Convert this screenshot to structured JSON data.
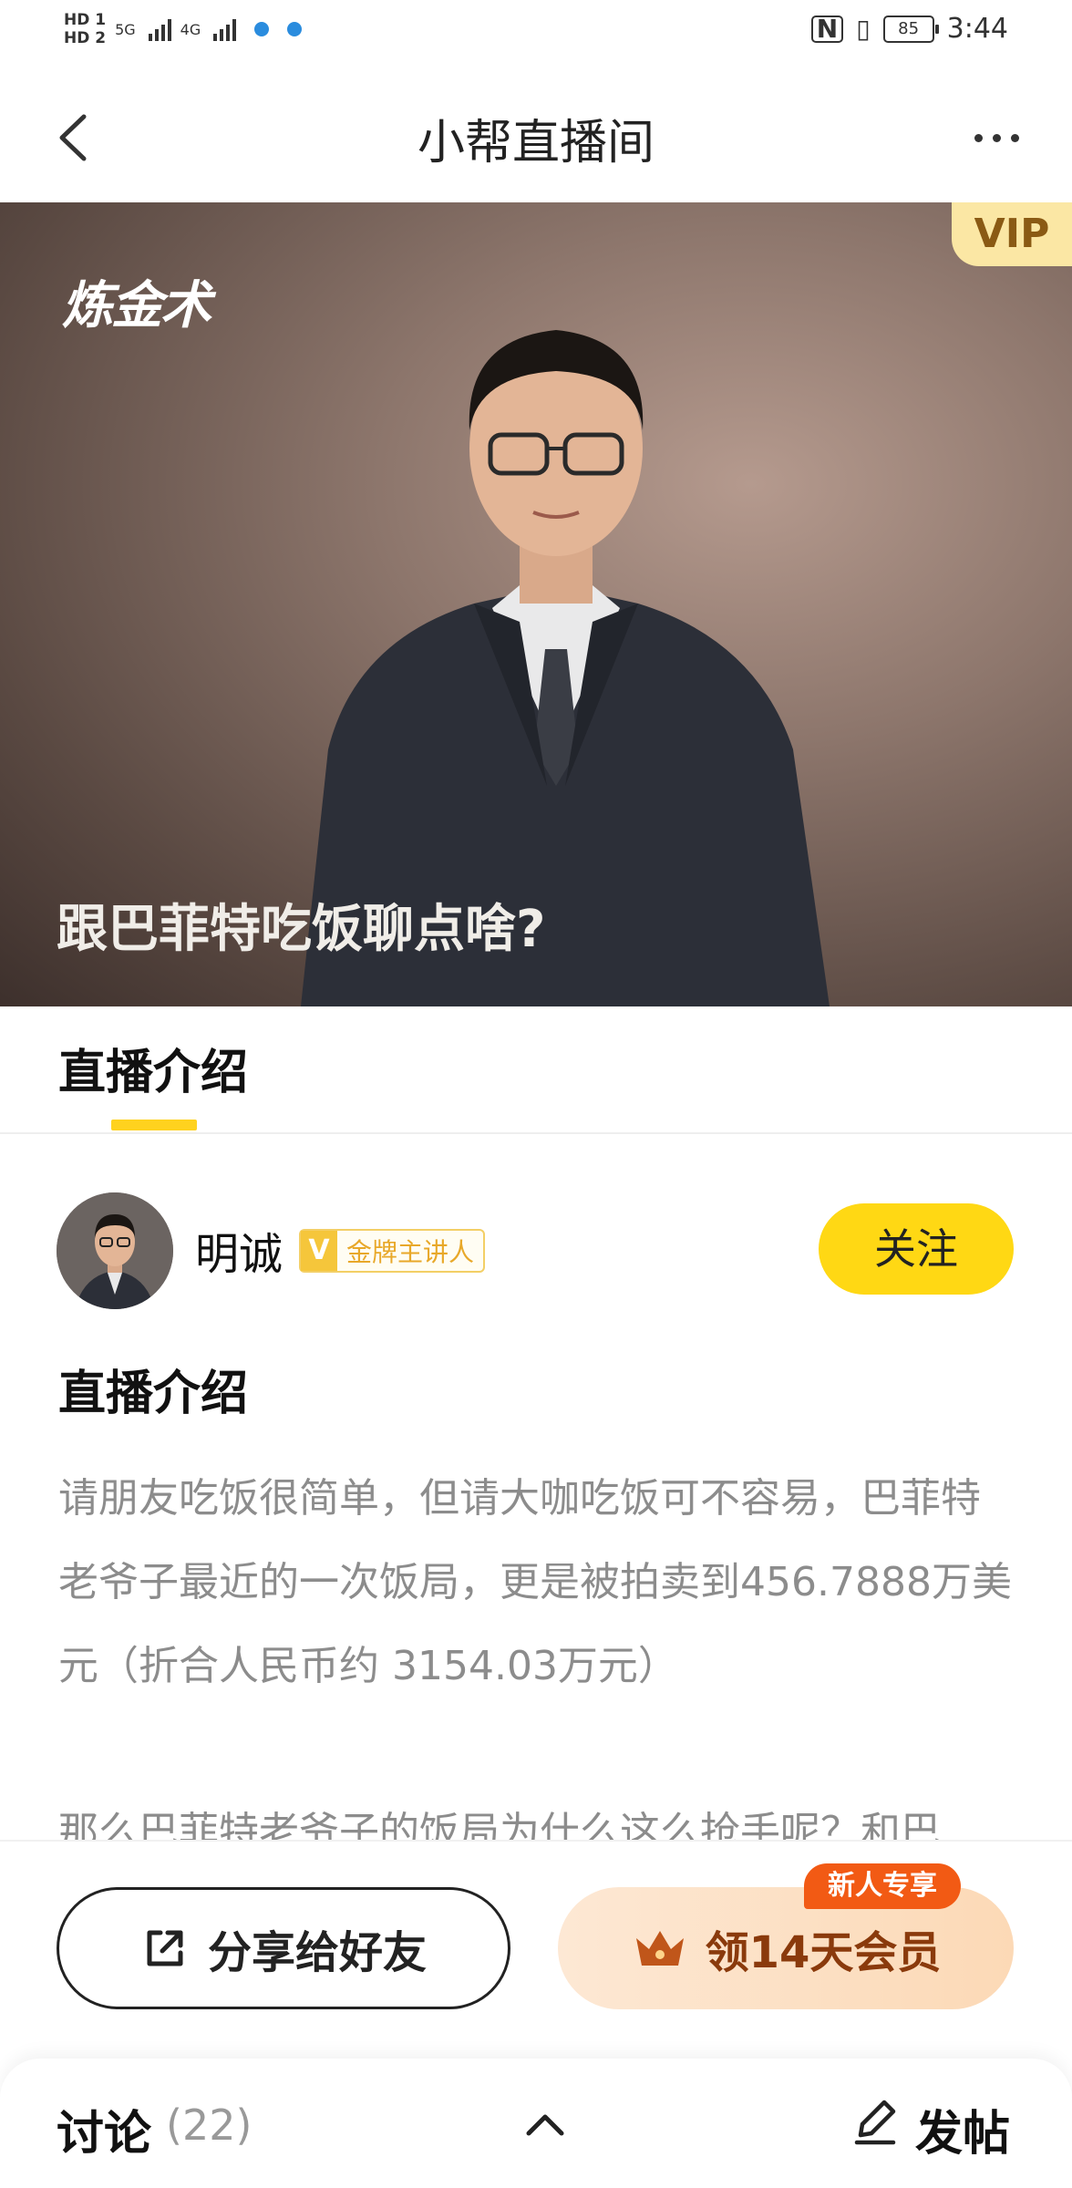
{
  "status_bar": {
    "sim1": "HD 1",
    "sim2": "HD 2",
    "net1": "5G",
    "net2": "4G",
    "battery": "85",
    "time": "3:44"
  },
  "nav": {
    "title": "小帮直播间"
  },
  "hero": {
    "logo": "炼金术",
    "vip": "VIP",
    "title": "跟巴菲特吃饭聊点啥?"
  },
  "tabs": [
    {
      "label": "直播介绍",
      "active": true
    }
  ],
  "author": {
    "name": "明诚",
    "badge_v": "V",
    "badge_text": "金牌主讲人",
    "follow_label": "关注"
  },
  "intro": {
    "title": "直播介绍",
    "paragraph1": "请朋友吃饭很简单，但请大咖吃饭可不容易，巴菲特老爷子最近的一次饭局，更是被拍卖到456.7888万美元（折合人民币约 3154.03万元）",
    "paragraph2": "那么巴菲特老爷子的饭局为什么这么抢手呢？和巴"
  },
  "actions": {
    "share_label": "分享给好友",
    "member_label": "领14天会员",
    "new_tag": "新人专享"
  },
  "discussion": {
    "label": "讨论",
    "count": "(22)",
    "post_label": "发帖"
  },
  "colors": {
    "accent_yellow": "#ffd814",
    "tag_orange": "#f25a14",
    "member_text": "#8a3a0c"
  }
}
